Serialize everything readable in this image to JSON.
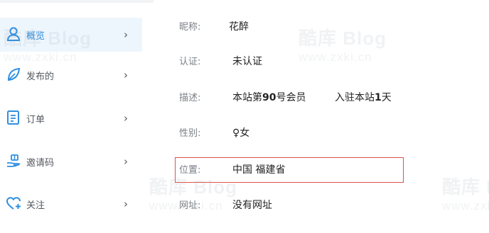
{
  "sidebar": {
    "items": [
      {
        "label": "概览",
        "icon": "user-icon",
        "active": true
      },
      {
        "label": "发布的",
        "icon": "leaf-icon",
        "active": false
      },
      {
        "label": "订单",
        "icon": "order-list-icon",
        "active": false
      },
      {
        "label": "邀请码",
        "icon": "hand-gift-icon",
        "active": false
      },
      {
        "label": "关注",
        "icon": "heart-plus-icon",
        "active": false
      }
    ],
    "chevron": "›"
  },
  "profile": {
    "nickname_label": "昵称:",
    "nickname_value": "花醉",
    "cert_label": "认证:",
    "cert_value": "未认证",
    "desc_label": "描述:",
    "desc_prefix": "本站第",
    "member_no": "90",
    "desc_suffix": "号会员",
    "joined_prefix": "入驻本站",
    "joined_days": "1",
    "joined_suffix": "天",
    "gender_label": "性别:",
    "gender_value": "♀女",
    "location_label": "位置:",
    "location_value": "中国 福建省",
    "website_label": "网址:",
    "website_value": "没有网址"
  },
  "watermark": {
    "brand": "酷库 Blog",
    "url": "www.zxki.cn"
  },
  "colors": {
    "accent": "#2f8fe0",
    "highlight_border": "#d9534f"
  }
}
